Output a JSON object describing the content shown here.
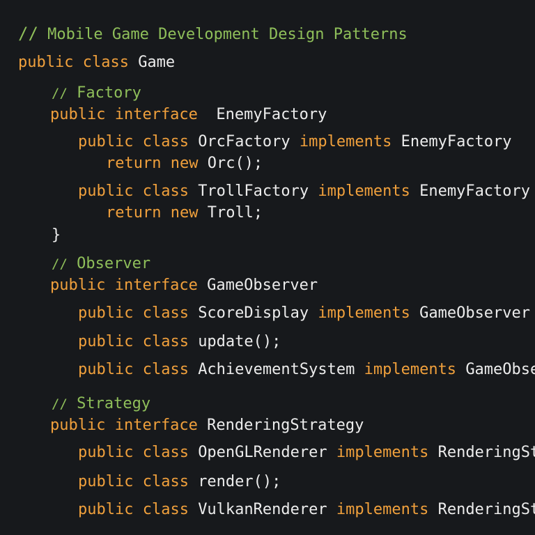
{
  "theme": {
    "background": "#17191c",
    "keyword_color": "#f0a03c",
    "comment_color": "#8fbf5a",
    "identifier_color": "#ececec"
  },
  "header": {
    "comment_slashes": "//",
    "comment_text": " Mobile Game Development Design Patterns"
  },
  "class_decl": {
    "keywords": "public class ",
    "name": "Game"
  },
  "sections": [
    {
      "comment_slashes": "//",
      "comment_text": " Factory",
      "interface_keywords": "public interface ",
      "interface_name": " EnemyFactory",
      "lines": [
        {
          "keywords": "public class ",
          "name": "OrcFactory",
          "impl": " implements ",
          "target": "EnemyFactory"
        },
        {
          "keywords": "return new ",
          "name": "Orc();"
        },
        {
          "keywords": "public class ",
          "name": "TrollFactory",
          "impl": " implements ",
          "target": "EnemyFactory"
        },
        {
          "keywords": "return new ",
          "name": "Troll;"
        }
      ],
      "closing_brace": "}"
    },
    {
      "comment_slashes": "//",
      "comment_text": " Observer",
      "interface_keywords": "public interface ",
      "interface_name": "GameObserver",
      "lines": [
        {
          "keywords": "public class ",
          "name": "ScoreDisplay",
          "impl": " implements ",
          "target": "GameObserver"
        },
        {
          "keywords": "public class ",
          "name": "update();"
        },
        {
          "keywords": "public class ",
          "name": "AchievementSystem",
          "impl": " implements ",
          "target": "GameObserver"
        }
      ]
    },
    {
      "comment_slashes": "//",
      "comment_text": " Strategy",
      "interface_keywords": "public interface ",
      "interface_name": "RenderingStrategy",
      "lines": [
        {
          "keywords": "public class ",
          "name": "OpenGLRenderer",
          "impl": " implements ",
          "target": "RenderingStrategy"
        },
        {
          "keywords": "public class ",
          "name": "render();"
        },
        {
          "keywords": "public class ",
          "name": "VulkanRenderer",
          "impl": " implements ",
          "target": "RenderingStrategy"
        }
      ]
    }
  ]
}
